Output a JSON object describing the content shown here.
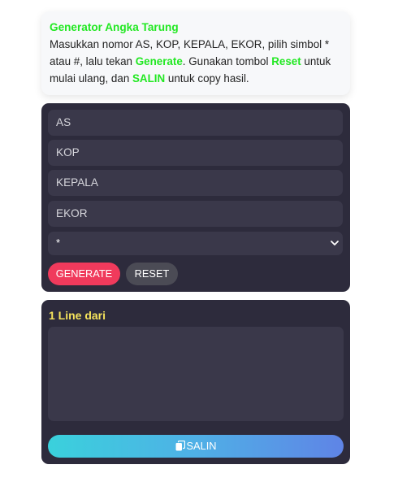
{
  "info": {
    "title": "Generator Angka Tarung",
    "text1": "Masukkan nomor AS, KOP, KEPALA, EKOR, pilih simbol * atau #, lalu tekan ",
    "generate_word": "Generate",
    "text2": ". Gunakan tombol ",
    "reset_word": "Reset",
    "text3": " untuk mulai ulang, dan ",
    "salin_word": "SALIN",
    "text4": " untuk copy hasil."
  },
  "form": {
    "as_placeholder": "AS",
    "kop_placeholder": "KOP",
    "kepala_placeholder": "KEPALA",
    "ekor_placeholder": "EKOR",
    "symbol_value": "*"
  },
  "buttons": {
    "generate": "GENERATE",
    "reset": "RESET",
    "salin": "SALIN"
  },
  "output": {
    "title": "1 Line dari",
    "value": ""
  },
  "icons": {
    "select": "chevron-down-icon",
    "copy": "copy-icon"
  },
  "colors": {
    "accent_green": "#22e822",
    "panel_bg": "#2d2b3c",
    "field_bg": "#3a384a",
    "generate_bg": "#f03a5c",
    "reset_bg": "#4b4b55",
    "output_title": "#f5e35c"
  }
}
